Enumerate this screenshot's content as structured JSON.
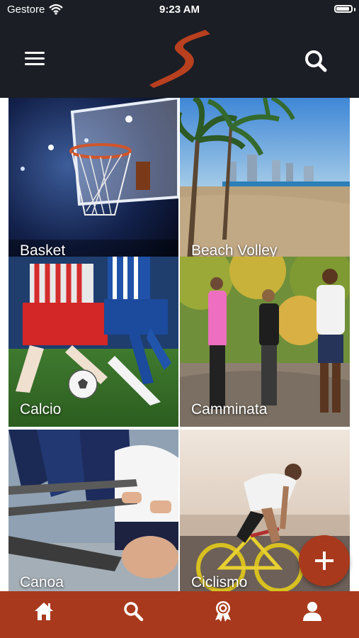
{
  "status_bar": {
    "carrier": "Gestore",
    "time": "9:23 AM"
  },
  "header": {
    "menu_icon": "hamburger-menu-icon",
    "logo_icon": "s-brush-logo",
    "search_icon": "search-icon"
  },
  "sports": [
    {
      "label": "Basket"
    },
    {
      "label": "Beach Volley"
    },
    {
      "label": "Calcio"
    },
    {
      "label": "Camminata"
    },
    {
      "label": "Canoa"
    },
    {
      "label": "Ciclismo"
    }
  ],
  "fab": {
    "icon": "plus-icon"
  },
  "bottom_nav": [
    {
      "icon": "home-icon"
    },
    {
      "icon": "search-icon"
    },
    {
      "icon": "award-ribbon-icon"
    },
    {
      "icon": "user-icon"
    }
  ],
  "colors": {
    "header_bg": "#1b1e24",
    "accent": "#a8391d",
    "text_on_dark": "#ffffff"
  }
}
